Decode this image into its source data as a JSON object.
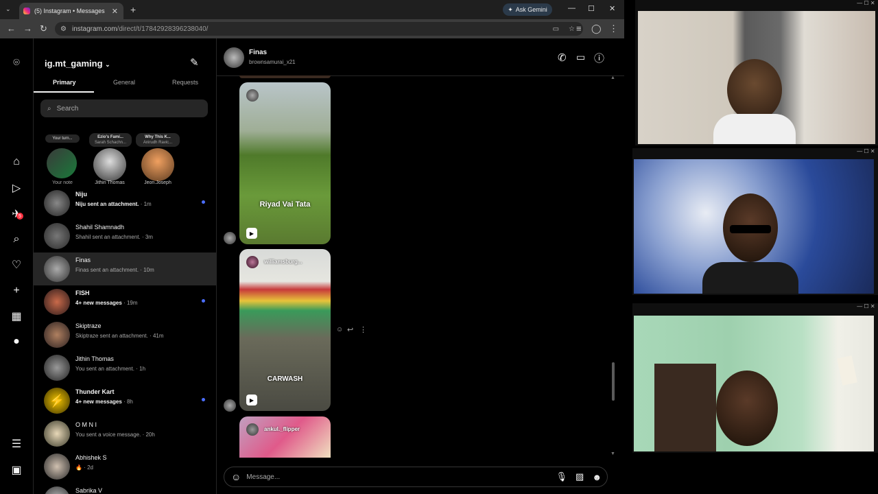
{
  "browser": {
    "tab_title": "(5) Instagram • Messages",
    "url_domain": "instagram.com",
    "url_path": "/direct/t/17842928396238040/",
    "gemini_label": "Ask Gemini",
    "new_tab": "+",
    "close": "✕"
  },
  "account": {
    "username": "ig.mt_gaming",
    "chevron": "⌄"
  },
  "inbox_tabs": [
    "Primary",
    "General",
    "Requests"
  ],
  "search_placeholder": "Search",
  "notes": [
    {
      "bubble": "Your turn...",
      "label": "Your note"
    },
    {
      "bubble": "Ezio's Fami...",
      "sub": "Sarah Schachn...",
      "label": "Jithin Thomas"
    },
    {
      "bubble": "Why This K...",
      "sub": "Anirudh Ravic...",
      "label": "Jeon.Joseph"
    }
  ],
  "conversations": [
    {
      "name": "Niju",
      "preview": "Niju sent an attachment.",
      "time": "· 1m",
      "unread": true
    },
    {
      "name": "Shahil Shamnadh",
      "preview": "Shahil sent an attachment.",
      "time": "· 3m",
      "unread": false
    },
    {
      "name": "Finas",
      "preview": "Finas sent an attachment.",
      "time": "· 10m",
      "unread": false,
      "selected": true
    },
    {
      "name": "FISH",
      "preview": "4+ new messages",
      "time": "· 19m",
      "unread": true
    },
    {
      "name": "Skiptraze",
      "preview": "Skiptraze sent an attachment.",
      "time": "· 41m",
      "unread": false
    },
    {
      "name": "Jithin Thomas",
      "preview": "You sent an attachment.",
      "time": "· 1h",
      "unread": false
    },
    {
      "name": "Thunder Kart",
      "preview": "4+ new messages",
      "time": "· 8h",
      "unread": true
    },
    {
      "name": "O M N I",
      "preview": "You sent a voice message.",
      "time": "· 20h",
      "unread": false
    },
    {
      "name": "Abhishek S",
      "preview": "🔥",
      "time": "· 2d",
      "unread": false
    },
    {
      "name": "Sabrika V",
      "preview": "",
      "time": "",
      "unread": false
    }
  ],
  "rail_badge": "5",
  "chat": {
    "name": "Finas",
    "handle": "brownsamurai_x21",
    "messages": [
      {
        "overlay": "Riyad Vai Tata"
      },
      {
        "overlay": "CARWASH",
        "account": "williamsburg..."
      },
      {
        "account": "ankul._flipper"
      }
    ],
    "composer_placeholder": "Message..."
  },
  "colors": {
    "accent": "#4b6eff",
    "badge": "#ff3040"
  }
}
